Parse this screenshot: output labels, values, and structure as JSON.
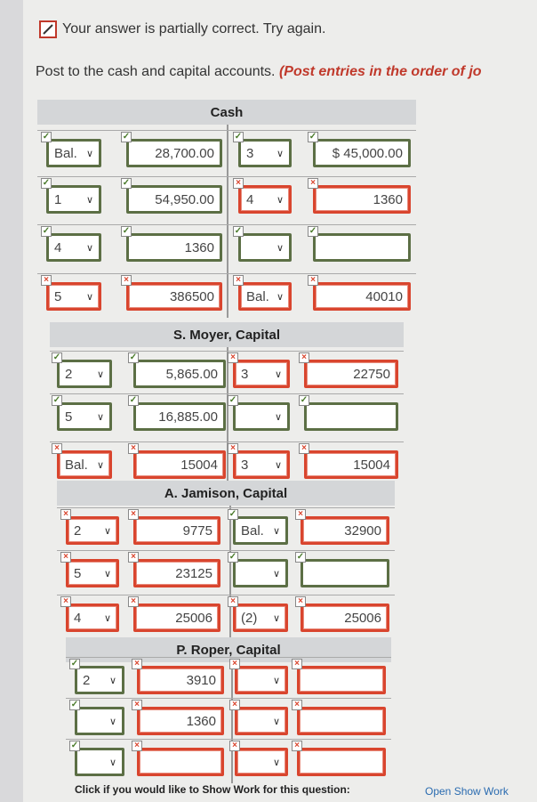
{
  "status": {
    "message": "Your answer is partially correct.  Try again."
  },
  "instruction": {
    "text": "Post to the cash and capital accounts. ",
    "emphasis": "(Post entries in the order of jo"
  },
  "sections": [
    {
      "title": "Cash",
      "rows": [
        {
          "l_sel": "Bal.",
          "l_amt": "28,700.00",
          "r_sel": "3",
          "r_amt": "$ 45,000.00",
          "marks": [
            "ok",
            "ok",
            "ok",
            "ok"
          ],
          "states": [
            "good",
            "good",
            "good",
            "good"
          ]
        },
        {
          "l_sel": "1",
          "l_amt": "54,950.00",
          "r_sel": "4",
          "r_amt": "1360",
          "marks": [
            "ok",
            "ok",
            "no",
            "no"
          ],
          "states": [
            "good",
            "good",
            "bad",
            "bad"
          ]
        },
        {
          "l_sel": "4",
          "l_amt": "1360",
          "r_sel": "",
          "r_amt": "",
          "marks": [
            "ok",
            "ok",
            "ok",
            "ok"
          ],
          "states": [
            "good",
            "good",
            "good",
            "good"
          ]
        },
        {
          "l_sel": "5",
          "l_amt": "386500",
          "r_sel": "Bal.",
          "r_amt": "40010",
          "marks": [
            "no",
            "no",
            "no",
            "no"
          ],
          "states": [
            "bad",
            "bad",
            "bad",
            "bad"
          ]
        }
      ]
    },
    {
      "title": "S. Moyer, Capital",
      "rows": [
        {
          "l_sel": "2",
          "l_amt": "5,865.00",
          "r_sel": "3",
          "r_amt": "22750",
          "marks": [
            "ok",
            "ok",
            "no",
            "no"
          ],
          "states": [
            "good",
            "good",
            "bad",
            "bad"
          ]
        },
        {
          "l_sel": "5",
          "l_amt": "16,885.00",
          "r_sel": "",
          "r_amt": "",
          "marks": [
            "ok",
            "ok",
            "ok",
            "ok"
          ],
          "states": [
            "good",
            "good",
            "good",
            "good"
          ]
        },
        {
          "l_sel": "Bal.",
          "l_amt": "15004",
          "r_sel": "3",
          "r_amt": "15004",
          "marks": [
            "no",
            "no",
            "no",
            "no"
          ],
          "states": [
            "bad",
            "bad",
            "bad",
            "bad"
          ]
        }
      ]
    },
    {
      "title": "A. Jamison, Capital",
      "rows": [
        {
          "l_sel": "2",
          "l_amt": "9775",
          "r_sel": "Bal.",
          "r_amt": "32900",
          "marks": [
            "no",
            "no",
            "ok",
            "no"
          ],
          "states": [
            "bad",
            "bad",
            "good",
            "bad"
          ]
        },
        {
          "l_sel": "5",
          "l_amt": "23125",
          "r_sel": "",
          "r_amt": "",
          "marks": [
            "no",
            "no",
            "ok",
            "ok"
          ],
          "states": [
            "bad",
            "bad",
            "good",
            "good"
          ]
        },
        {
          "l_sel": "4",
          "l_amt": "25006",
          "r_sel": "(2)",
          "r_amt": "25006",
          "marks": [
            "no",
            "no",
            "no",
            "no"
          ],
          "states": [
            "bad",
            "bad",
            "bad",
            "bad"
          ]
        }
      ]
    },
    {
      "title": "P. Roper, Capital",
      "rows": [
        {
          "l_sel": "2",
          "l_amt": "3910",
          "r_sel": "",
          "r_amt": "",
          "marks": [
            "ok",
            "no",
            "no",
            "no"
          ],
          "states": [
            "good",
            "bad",
            "bad",
            "bad"
          ]
        },
        {
          "l_sel": "",
          "l_amt": "1360",
          "r_sel": "",
          "r_amt": "",
          "marks": [
            "ok",
            "no",
            "no",
            "no"
          ],
          "states": [
            "good",
            "bad",
            "bad",
            "bad"
          ]
        },
        {
          "l_sel": "",
          "l_amt": "",
          "r_sel": "",
          "r_amt": "",
          "marks": [
            "ok",
            "no",
            "no",
            "no"
          ],
          "states": [
            "good",
            "bad",
            "bad",
            "bad"
          ]
        }
      ]
    }
  ],
  "footer": {
    "prompt": "Click if you would like to Show Work for this question:",
    "link": "Open Show Work"
  }
}
